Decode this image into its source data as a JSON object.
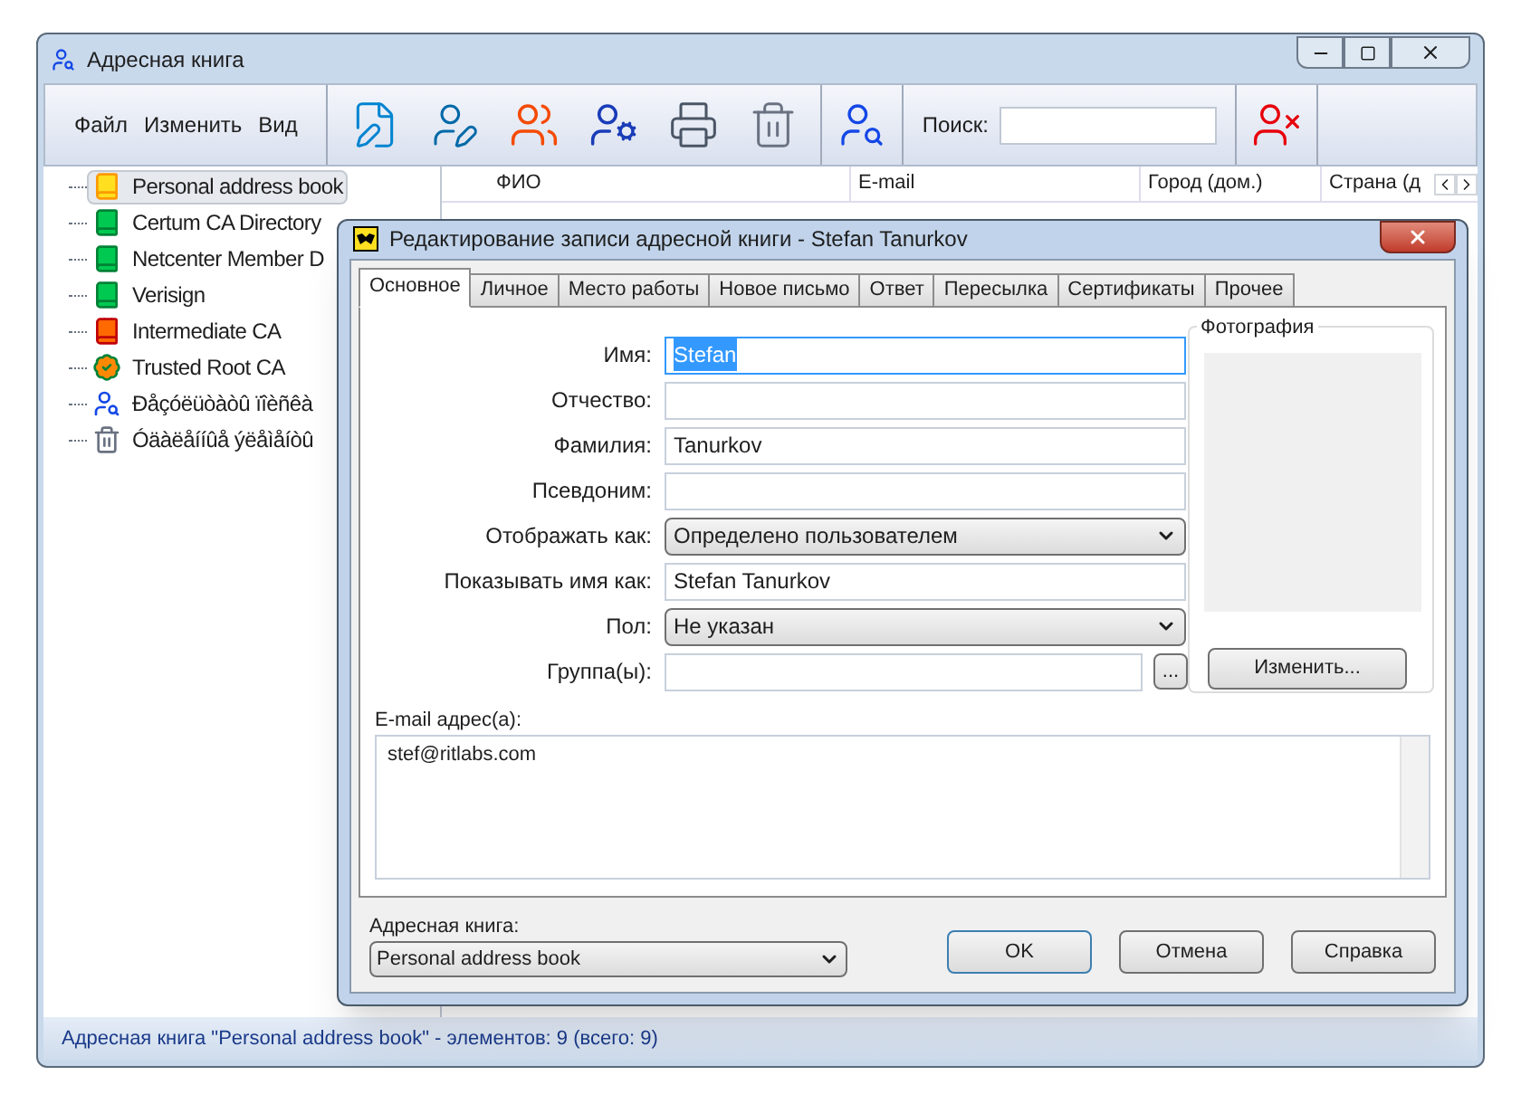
{
  "window": {
    "title": "Адресная книга"
  },
  "menu": [
    "Файл",
    "Изменить",
    "Вид"
  ],
  "search": {
    "label": "Поиск:"
  },
  "tree": [
    {
      "label": "Personal address book",
      "kind": "book",
      "selected": true
    },
    {
      "label": "Certum CA Directory",
      "kind": "ldap",
      "selected": false
    },
    {
      "label": "Netcenter Member D",
      "kind": "ldap",
      "selected": false
    },
    {
      "label": "Verisign",
      "kind": "ldap",
      "selected": false
    },
    {
      "label": "Intermediate CA",
      "kind": "cert",
      "selected": false
    },
    {
      "label": "Trusted Root CA",
      "kind": "trusted",
      "selected": false
    },
    {
      "label": "Đåçóëüòàòû ïîèñêà",
      "kind": "search",
      "selected": false
    },
    {
      "label": "Óäàëåííûå ýëåìåíòû",
      "kind": "trash",
      "selected": false
    }
  ],
  "table": {
    "columns": [
      "ФИО",
      "E-mail",
      "Город (дом.)",
      "Страна (д"
    ]
  },
  "status_bar": "Адресная книга \"Personal address book\" - элементов: 9 (всего: 9)",
  "dialog": {
    "title": "Редактирование записи адресной книги - Stefan Tanurkov",
    "tabs": [
      {
        "label": "Основное",
        "selected": true
      },
      {
        "label": "Личное",
        "selected": false
      },
      {
        "label": "Место работы",
        "selected": false
      },
      {
        "label": "Новое письмо",
        "selected": false
      },
      {
        "label": "Ответ",
        "selected": false
      },
      {
        "label": "Пересылка",
        "selected": false
      },
      {
        "label": "Сертификаты",
        "selected": false
      },
      {
        "label": "Прочее",
        "selected": false
      }
    ],
    "fields": [
      {
        "label": "Имя:",
        "kind": "text",
        "value": "Stefan",
        "highlighted": true
      },
      {
        "label": "Отчество:",
        "kind": "text",
        "highlighted": false
      },
      {
        "label": "Фамилия:",
        "kind": "text",
        "value": "Tanurkov",
        "highlighted": false
      },
      {
        "label": "Псевдоним:",
        "kind": "text",
        "highlighted": false
      },
      {
        "label": "Отображать как:",
        "kind": "select",
        "value": "Определено пользователем",
        "highlighted": false
      },
      {
        "label": "Показывать имя как:",
        "kind": "text",
        "value": "Stefan Tanurkov",
        "highlighted": false
      },
      {
        "label": "Пол:",
        "kind": "select",
        "value": "Не указан",
        "highlighted": false
      },
      {
        "label": "Группа(ы):",
        "kind": "group",
        "button": "...",
        "highlighted": false
      }
    ],
    "photo": {
      "title": "Фотография",
      "button": "Изменить..."
    },
    "email": {
      "label": "E-mail адрес(а):",
      "value": "stef@ritlabs.com"
    },
    "address_book": {
      "label": "Адресная книга:",
      "value": "Personal address book"
    },
    "buttons": [
      "OK",
      "Отмена",
      "Справка"
    ]
  }
}
